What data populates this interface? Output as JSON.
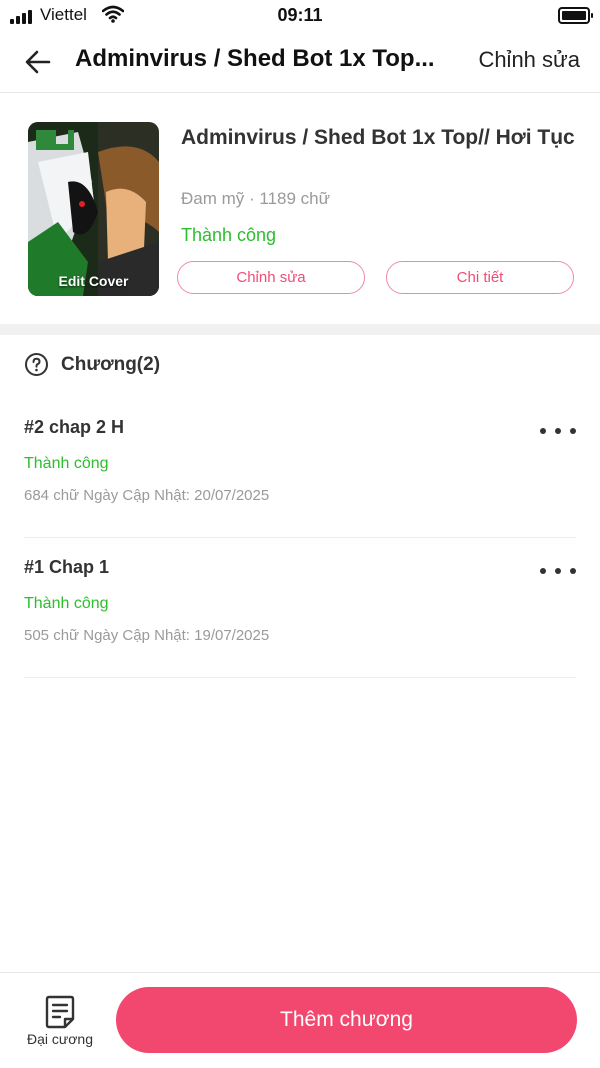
{
  "status_bar": {
    "carrier": "Viettel",
    "time": "09:11"
  },
  "nav": {
    "title": "Adminvirus / Shed Bot 1x Top...",
    "edit_label": "Chỉnh sửa",
    "back_icon": "arrow-left-icon"
  },
  "story": {
    "title": "Adminvirus / Shed Bot 1x Top// Hơi Tục",
    "meta": "Đam mỹ · 1189 chữ",
    "status": "Thành công",
    "cover_label": "Edit Cover",
    "edit_button": "Chỉnh sửa",
    "detail_button": "Chi tiết"
  },
  "chapters": {
    "header": "Chương(2)",
    "items": [
      {
        "title": "#2 chap 2 H",
        "status": "Thành công",
        "meta": "684 chữ Ngày Cập Nhật: 20/07/2025"
      },
      {
        "title": "#1 Chap 1",
        "status": "Thành công",
        "meta": "505 chữ Ngày Cập Nhật: 19/07/2025"
      }
    ]
  },
  "bottom": {
    "outline_label": "Đại cương",
    "add_chapter_label": "Thêm chương"
  },
  "colors": {
    "accent": "#f2486f",
    "success": "#2dbd2d",
    "pill_border": "#f08aa4",
    "muted": "#9a9a9a"
  }
}
